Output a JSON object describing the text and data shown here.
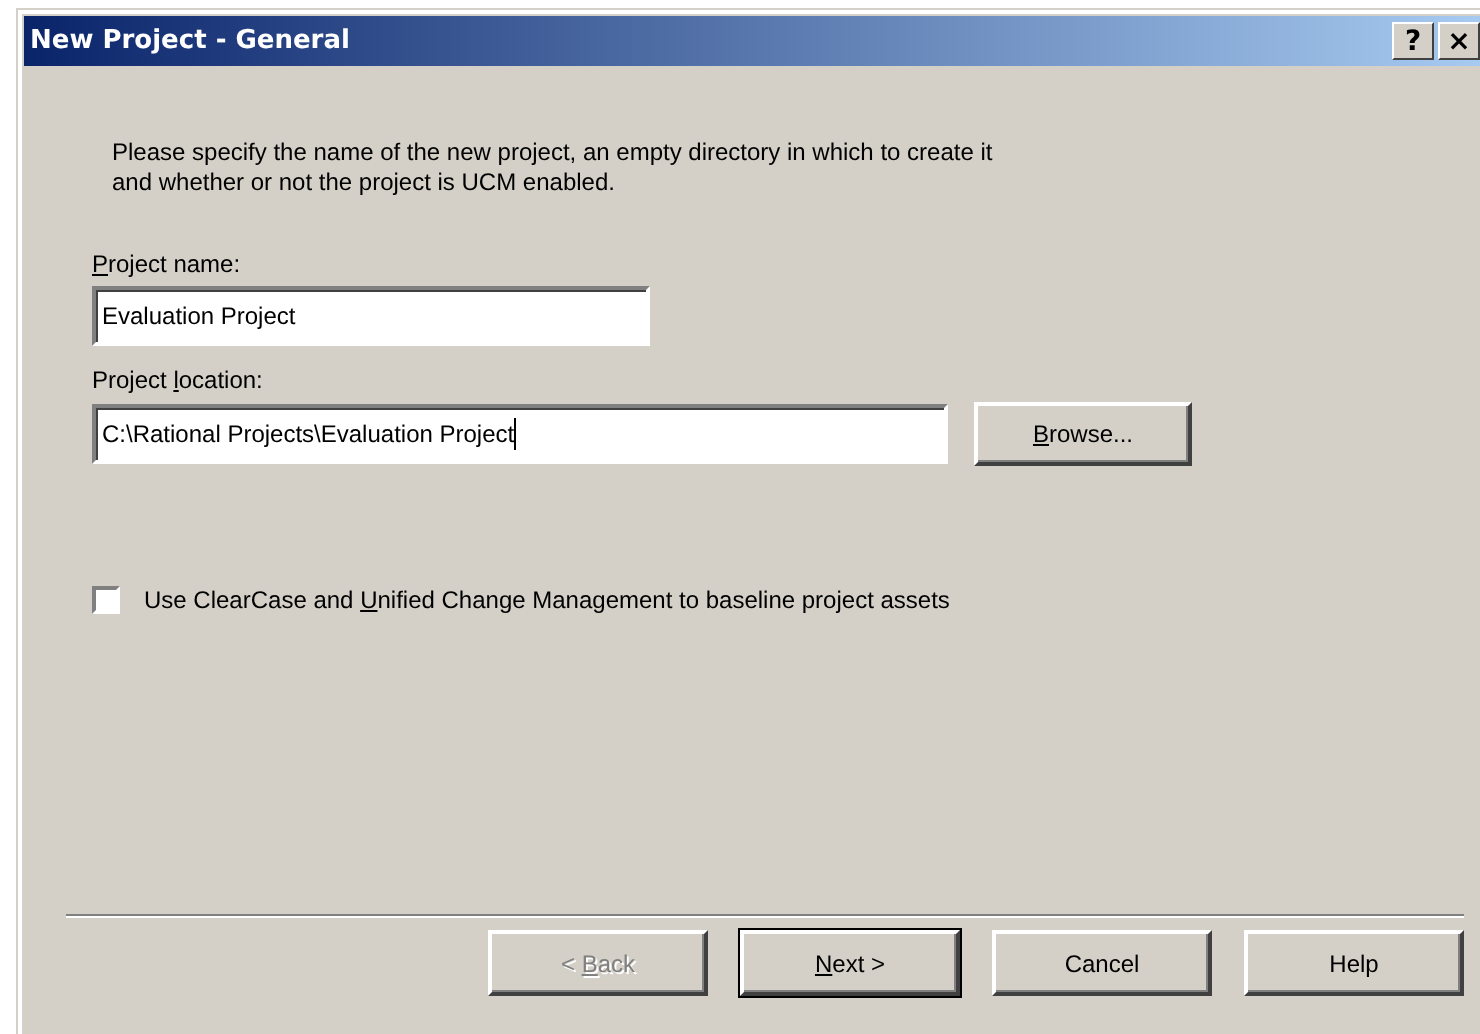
{
  "window": {
    "title": "New Project - General",
    "help_button": "?",
    "close_button": "×"
  },
  "description": "Please specify the name of the new project, an empty directory in which to create it and whether or not the project is UCM enabled.",
  "fields": [
    {
      "label": {
        "key": "P",
        "after": "roject name:"
      },
      "value": "Evaluation Project",
      "focused": false
    },
    {
      "label": {
        "before": "Project ",
        "key": "l",
        "after": "ocation:"
      },
      "value": "C:\\Rational Projects\\Evaluation Project",
      "focused": true
    }
  ],
  "browse_button": {
    "key": "B",
    "after": "rowse..."
  },
  "checkbox": {
    "label": {
      "before": "Use ClearCase and ",
      "key": "U",
      "after": "nified Change Management to baseline project assets"
    },
    "checked": false
  },
  "buttons": [
    {
      "label": {
        "before": "< ",
        "key": "B",
        "after": "ack"
      },
      "disabled": true,
      "default": false
    },
    {
      "label": {
        "key": "N",
        "after": "ext >"
      },
      "disabled": false,
      "default": true
    },
    {
      "label": {
        "after": "Cancel"
      },
      "disabled": false,
      "default": false
    },
    {
      "label": {
        "after": "Help"
      },
      "disabled": false,
      "default": false
    }
  ]
}
